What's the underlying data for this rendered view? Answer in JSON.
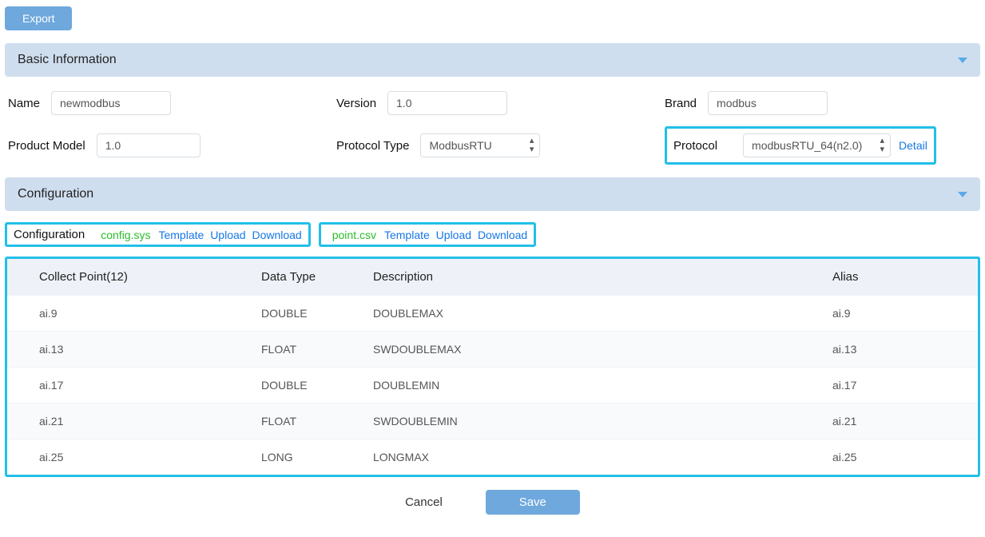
{
  "top": {
    "export": "Export"
  },
  "basic": {
    "title": "Basic Information",
    "name_label": "Name",
    "name_value": "newmodbus",
    "version_label": "Version",
    "version_value": "1.0",
    "brand_label": "Brand",
    "brand_value": "modbus",
    "pmodel_label": "Product Model",
    "pmodel_value": "1.0",
    "ptype_label": "Protocol Type",
    "ptype_value": "ModbusRTU",
    "protocol_label": "Protocol",
    "protocol_value": "modbusRTU_64(n2.0)",
    "detail": "Detail"
  },
  "config": {
    "title": "Configuration",
    "config_label": "Configuration",
    "file1": "config.sys",
    "file2": "point.csv",
    "template": "Template",
    "upload": "Upload",
    "download": "Download"
  },
  "table": {
    "headers": {
      "collect": "Collect Point(12)",
      "dtype": "Data Type",
      "desc": "Description",
      "alias": "Alias"
    },
    "rows": [
      {
        "cp": "ai.9",
        "dt": "DOUBLE",
        "desc": "DOUBLEMAX",
        "alias": "ai.9"
      },
      {
        "cp": "ai.13",
        "dt": "FLOAT",
        "desc": "SWDOUBLEMAX",
        "alias": "ai.13"
      },
      {
        "cp": "ai.17",
        "dt": "DOUBLE",
        "desc": "DOUBLEMIN",
        "alias": "ai.17"
      },
      {
        "cp": "ai.21",
        "dt": "FLOAT",
        "desc": "SWDOUBLEMIN",
        "alias": "ai.21"
      },
      {
        "cp": "ai.25",
        "dt": "LONG",
        "desc": "LONGMAX",
        "alias": "ai.25"
      }
    ]
  },
  "footer": {
    "cancel": "Cancel",
    "save": "Save"
  }
}
